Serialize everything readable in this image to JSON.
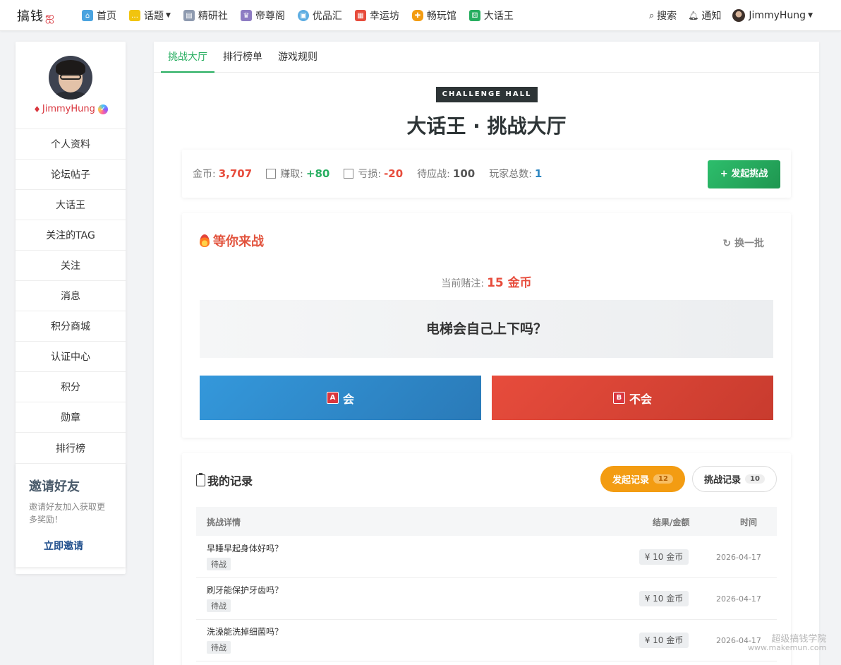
{
  "nav": {
    "logo": "搞钱",
    "items": [
      {
        "label": "首页",
        "icon": "home-icon",
        "color": "#4aa3df"
      },
      {
        "label": "话题",
        "icon": "chat-icon",
        "color": "#f1c40f",
        "dropdown": true
      },
      {
        "label": "精研社",
        "icon": "book-icon",
        "color": "#8e9aaf"
      },
      {
        "label": "帝尊阁",
        "icon": "crown-icon",
        "color": "#8e7cc3"
      },
      {
        "label": "优品汇",
        "icon": "bag-icon",
        "color": "#5dade2"
      },
      {
        "label": "幸运坊",
        "icon": "gift-icon",
        "color": "#e74c3c"
      },
      {
        "label": "畅玩馆",
        "icon": "gamepad-icon",
        "color": "#f39c12"
      },
      {
        "label": "大话王",
        "icon": "dice-icon",
        "color": "#27ae60"
      }
    ],
    "search": "搜索",
    "notify": "通知",
    "user": "JimmyHung"
  },
  "sidebar": {
    "username": "JimmyHung",
    "menu": [
      "个人资料",
      "论坛帖子",
      "大话王",
      "关注的TAG",
      "关注",
      "消息",
      "积分商城",
      "认证中心",
      "积分",
      "勋章",
      "排行榜"
    ],
    "invite": {
      "title": "邀请好友",
      "desc": "邀请好友加入获取更多奖励！",
      "link": "立即邀请"
    }
  },
  "tabs": [
    "挑战大厅",
    "排行榜单",
    "游戏规则"
  ],
  "hall": {
    "badge": "CHALLENGE HALL",
    "title": "大话王 · 挑战大厅"
  },
  "stats": {
    "coins_label": "金币:",
    "coins": "3,707",
    "earn_label": "赚取:",
    "earn": "+80",
    "loss_label": "亏损:",
    "loss": "-20",
    "pending_label": "待应战:",
    "pending": "100",
    "players_label": "玩家总数:",
    "players": "1",
    "launch": "+ 发起挑战"
  },
  "battle": {
    "title": "等你来战",
    "refresh": "换一批",
    "wager_label": "当前赌注:",
    "wager": "15 金币",
    "question": "电梯会自己上下吗？",
    "option_a_key": "A",
    "option_a": "会",
    "option_b_key": "B",
    "option_b": "不会"
  },
  "records": {
    "title": "我的记录",
    "tab_launch": "发起记录",
    "tab_launch_count": "12",
    "tab_challenge": "挑战记录",
    "tab_challenge_count": "10",
    "col_detail": "挑战详情",
    "col_result": "结果/金额",
    "col_time": "时间",
    "rows": [
      {
        "question": "早睡早起身体好吗？",
        "status": "待战",
        "amount": "¥ 10 金币",
        "time": "2026-04-17"
      },
      {
        "question": "刷牙能保护牙齿吗？",
        "status": "待战",
        "amount": "¥ 10 金币",
        "time": "2026-04-17"
      },
      {
        "question": "洗澡能洗掉细菌吗？",
        "status": "待战",
        "amount": "¥ 10 金币",
        "time": "2026-04-17"
      }
    ]
  },
  "watermark": {
    "line1": "超级搞钱学院",
    "line2": "www.makemun.com"
  },
  "colors": {
    "accent_green": "#27ae60",
    "red": "#e74c3c",
    "blue": "#3498db",
    "orange": "#f39c12"
  }
}
